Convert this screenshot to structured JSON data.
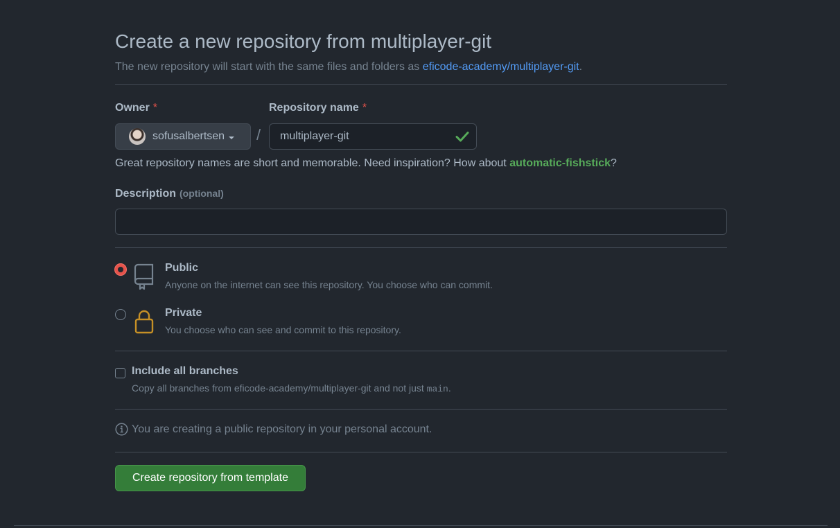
{
  "header": {
    "title": "Create a new repository from multiplayer-git",
    "subtitle_prefix": "The new repository will start with the same files and folders as ",
    "subtitle_link": "eficode-academy/multiplayer-git",
    "subtitle_suffix": "."
  },
  "owner": {
    "label": "Owner",
    "required_mark": "*",
    "value": "sofusalbertsen"
  },
  "separator": "/",
  "repo_name": {
    "label": "Repository name",
    "required_mark": "*",
    "value": "multiplayer-git",
    "status": "valid"
  },
  "hint": {
    "prefix": "Great repository names are short and memorable. Need inspiration? How about ",
    "suggestion": "automatic-fishstick",
    "suffix": "?"
  },
  "description": {
    "label": "Description",
    "optional_note": "(optional)",
    "value": ""
  },
  "visibility": {
    "selected": "public",
    "options": [
      {
        "id": "public",
        "title": "Public",
        "desc": "Anyone on the internet can see this repository. You choose who can commit.",
        "icon": "repo-icon"
      },
      {
        "id": "private",
        "title": "Private",
        "desc": "You choose who can see and commit to this repository.",
        "icon": "lock-icon"
      }
    ]
  },
  "branches": {
    "label": "Include all branches",
    "checked": false,
    "desc_prefix": "Copy all branches from eficode-academy/multiplayer-git and not just ",
    "desc_code": "main",
    "desc_suffix": "."
  },
  "info": {
    "icon": "info-icon",
    "text": "You are creating a public repository in your personal account."
  },
  "submit": {
    "label": "Create repository from template"
  },
  "colors": {
    "background": "#22272e",
    "accent_link": "#539bf5",
    "success": "#57ab5a",
    "primary_button": "#347d39",
    "radio_selected": "#e5534b",
    "lock_icon": "#c69026"
  }
}
